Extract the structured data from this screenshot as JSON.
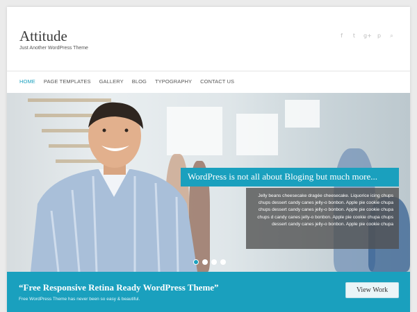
{
  "site": {
    "title": "Attitude",
    "description": "Just Another WordPress Theme"
  },
  "social_icons": [
    "facebook-icon",
    "twitter-icon",
    "google-plus-icon",
    "pinterest-icon",
    "search-icon"
  ],
  "social_glyphs": [
    "f",
    "t",
    "g+",
    "p",
    "⌕"
  ],
  "nav": {
    "items": [
      "HOME",
      "PAGE TEMPLATES",
      "GALLERY",
      "BLOG",
      "TYPOGRAPHY",
      "CONTACT US"
    ],
    "active_index": 0
  },
  "slider": {
    "caption_title": "WordPress is not all about Bloging but much more...",
    "caption_text": "Jelly beans cheesecake dragée cheesecake. Liquorice icing chups chups dessert candy canes jelly-o bonbon. Apple pie cookie chupa chups dessert candy canes jelly-o bonbon. Apple pie cookie chupa chups d candy canes jelly-o bonbon. Apple pie cookie chupa chups dessert candy canes jelly-o bonbon. Apple pie cookie chupa",
    "slide_count": 4,
    "active_slide": 0
  },
  "promo": {
    "title": "“Free Responsive Retina Ready WordPress Theme”",
    "subtitle": "Free WordPress Theme has never been so easy & beautiful.",
    "button_label": "View Work"
  },
  "colors": {
    "accent": "#1aa0be",
    "background": "#ebebeb",
    "caption_overlay": "#505050"
  }
}
